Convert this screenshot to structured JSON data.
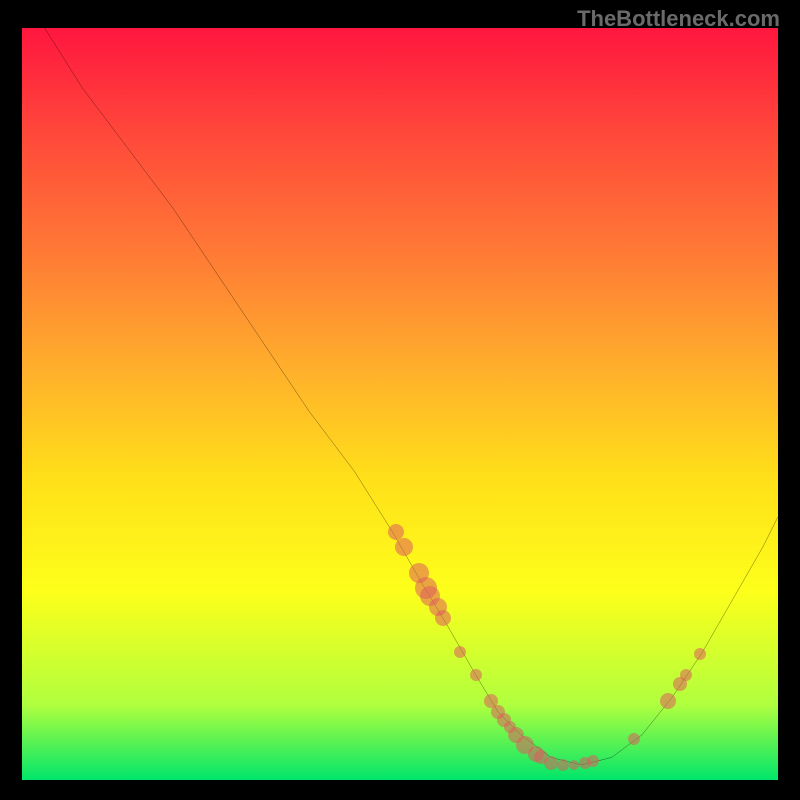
{
  "watermark": "TheBottleneck.com",
  "chart_data": {
    "type": "line",
    "title": "",
    "xlabel": "",
    "ylabel": "",
    "xlim": [
      0,
      100
    ],
    "ylim": [
      0,
      100
    ],
    "curve": {
      "x": [
        3,
        8,
        14,
        20,
        26,
        32,
        38,
        44,
        49,
        53,
        56,
        60,
        63,
        66,
        70,
        74,
        78,
        82,
        86,
        90,
        94,
        98,
        100
      ],
      "y": [
        100,
        92,
        84,
        76,
        67,
        58,
        49,
        41,
        33,
        26,
        21,
        14,
        9,
        6,
        3,
        2,
        3,
        6,
        11,
        17,
        24,
        31,
        35
      ]
    },
    "series": [
      {
        "name": "markers",
        "points": [
          {
            "x": 49.5,
            "y": 33,
            "r": 8
          },
          {
            "x": 50.5,
            "y": 31,
            "r": 9
          },
          {
            "x": 52.5,
            "y": 27.5,
            "r": 10
          },
          {
            "x": 53.5,
            "y": 25.5,
            "r": 11
          },
          {
            "x": 54.0,
            "y": 24.5,
            "r": 10
          },
          {
            "x": 55.0,
            "y": 23.0,
            "r": 9
          },
          {
            "x": 55.7,
            "y": 21.5,
            "r": 8
          },
          {
            "x": 58.0,
            "y": 17.0,
            "r": 6
          },
          {
            "x": 60.0,
            "y": 14.0,
            "r": 6
          },
          {
            "x": 62.0,
            "y": 10.5,
            "r": 7
          },
          {
            "x": 63.0,
            "y": 9.0,
            "r": 7
          },
          {
            "x": 63.7,
            "y": 8.0,
            "r": 7
          },
          {
            "x": 64.5,
            "y": 7.0,
            "r": 6
          },
          {
            "x": 65.3,
            "y": 6.0,
            "r": 8
          },
          {
            "x": 66.5,
            "y": 4.7,
            "r": 9
          },
          {
            "x": 68.0,
            "y": 3.5,
            "r": 8
          },
          {
            "x": 68.7,
            "y": 3.0,
            "r": 7
          },
          {
            "x": 70.0,
            "y": 2.3,
            "r": 7
          },
          {
            "x": 71.5,
            "y": 2.0,
            "r": 6
          },
          {
            "x": 73.0,
            "y": 2.0,
            "r": 5
          },
          {
            "x": 74.5,
            "y": 2.2,
            "r": 6
          },
          {
            "x": 75.5,
            "y": 2.5,
            "r": 6
          },
          {
            "x": 81.0,
            "y": 5.5,
            "r": 6
          },
          {
            "x": 85.5,
            "y": 10.5,
            "r": 8
          },
          {
            "x": 87.0,
            "y": 12.8,
            "r": 7
          },
          {
            "x": 87.8,
            "y": 14.0,
            "r": 6
          },
          {
            "x": 89.7,
            "y": 16.8,
            "r": 6
          }
        ]
      }
    ]
  }
}
